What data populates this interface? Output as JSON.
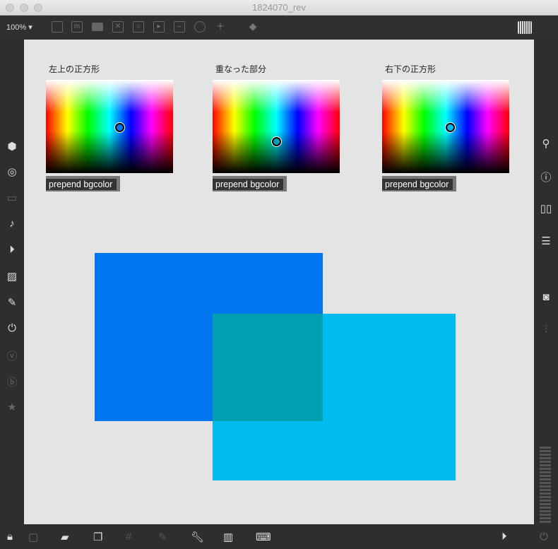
{
  "window": {
    "title": "1824070_rev"
  },
  "toolbar": {
    "zoom": "100%",
    "icons": [
      "presentation-icon",
      "message-icon",
      "comment-icon",
      "button-icon",
      "toggle-icon",
      "play-icon",
      "slider-icon",
      "dial-icon",
      "plus-icon",
      "paint-bucket-icon",
      "grid-icon"
    ]
  },
  "pickers": [
    {
      "label": "左上の正方形",
      "message": "prepend bgcolor",
      "color": "#0077ee"
    },
    {
      "label": "重なった部分",
      "message": "prepend bgcolor",
      "color": "#00a0b0"
    },
    {
      "label": "右下の正方形",
      "message": "prepend bgcolor",
      "color": "#00bbf0"
    }
  ],
  "panels": {
    "top_left": "#0077ee",
    "bottom_right": "#00bbf0",
    "overlap": "#00a0b0"
  }
}
